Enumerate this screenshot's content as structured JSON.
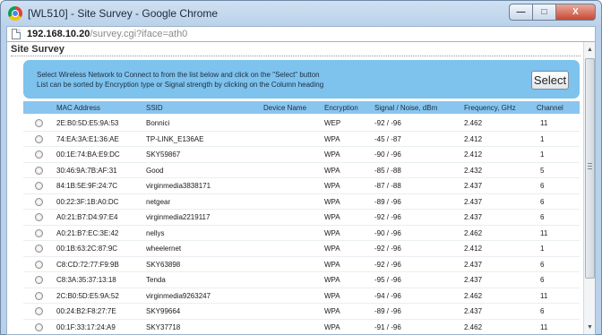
{
  "window": {
    "title": "[WL510] - Site Survey - Google Chrome",
    "controls": {
      "minimize": "—",
      "maximize": "□",
      "close": "X"
    }
  },
  "address": {
    "host": "192.168.10.20",
    "path": "/survey.cgi?iface=ath0"
  },
  "page": {
    "section_title": "Site Survey",
    "info_line1": "Select Wireless Network to Connect to from the list below and click on the \"Select\" button",
    "info_line2": "List can be sorted by Encryption type or Signal strength by clicking on the Column heading",
    "select_label": "Select"
  },
  "table": {
    "headers": {
      "mac": "MAC Address",
      "ssid": "SSID",
      "device": "Device Name",
      "encryption": "Encryption",
      "signal": "Signal / Noise, dBm",
      "frequency": "Frequency, GHz",
      "channel": "Channel"
    },
    "rows": [
      {
        "mac": "2E:B0:5D:E5:9A:53",
        "ssid": "Bonnici",
        "device": "",
        "encryption": "WEP",
        "signal": "-92 / -96",
        "frequency": "2.462",
        "channel": "11"
      },
      {
        "mac": "74:EA:3A:E1:36:AE",
        "ssid": "TP-LINK_E136AE",
        "device": "",
        "encryption": "WPA",
        "signal": "-45 / -87",
        "frequency": "2.412",
        "channel": "1"
      },
      {
        "mac": "00:1E:74:BA:E9:DC",
        "ssid": "SKY59867",
        "device": "",
        "encryption": "WPA",
        "signal": "-90 / -96",
        "frequency": "2.412",
        "channel": "1"
      },
      {
        "mac": "30:46:9A:7B:AF:31",
        "ssid": "Good",
        "device": "",
        "encryption": "WPA",
        "signal": "-85 / -88",
        "frequency": "2.432",
        "channel": "5"
      },
      {
        "mac": "84:1B:5E:9F:24:7C",
        "ssid": "virginmedia3838171",
        "device": "",
        "encryption": "WPA",
        "signal": "-87 / -88",
        "frequency": "2.437",
        "channel": "6"
      },
      {
        "mac": "00:22:3F:1B:A0:DC",
        "ssid": "netgear",
        "device": "",
        "encryption": "WPA",
        "signal": "-89 / -96",
        "frequency": "2.437",
        "channel": "6"
      },
      {
        "mac": "A0:21:B7:D4:97:E4",
        "ssid": "virginmedia2219117",
        "device": "",
        "encryption": "WPA",
        "signal": "-92 / -96",
        "frequency": "2.437",
        "channel": "6"
      },
      {
        "mac": "A0:21:B7:EC:3E:42",
        "ssid": "nellys",
        "device": "",
        "encryption": "WPA",
        "signal": "-90 / -96",
        "frequency": "2.462",
        "channel": "11"
      },
      {
        "mac": "00:1B:63:2C:87:9C",
        "ssid": "wheelernet",
        "device": "",
        "encryption": "WPA",
        "signal": "-92 / -96",
        "frequency": "2.412",
        "channel": "1"
      },
      {
        "mac": "C8:CD:72:77:F9:9B",
        "ssid": "SKY63898",
        "device": "",
        "encryption": "WPA",
        "signal": "-92 / -96",
        "frequency": "2.437",
        "channel": "6"
      },
      {
        "mac": "C8:3A:35:37:13:18",
        "ssid": "Tenda",
        "device": "",
        "encryption": "WPA",
        "signal": "-95 / -96",
        "frequency": "2.437",
        "channel": "6"
      },
      {
        "mac": "2C:B0:5D:E5:9A:52",
        "ssid": "virginmedia9263247",
        "device": "",
        "encryption": "WPA",
        "signal": "-94 / -96",
        "frequency": "2.462",
        "channel": "11"
      },
      {
        "mac": "00:24:B2:F8:27:7E",
        "ssid": "SKY99664",
        "device": "",
        "encryption": "WPA",
        "signal": "-89 / -96",
        "frequency": "2.437",
        "channel": "6"
      },
      {
        "mac": "00:1F:33:17:24:A9",
        "ssid": "SKY37718",
        "device": "",
        "encryption": "WPA",
        "signal": "-91 / -96",
        "frequency": "2.462",
        "channel": "11"
      }
    ]
  },
  "scrollbar": {
    "up_icon": "▲",
    "down_icon": "▼"
  },
  "colors": {
    "info_box": "#7ec2ee",
    "header_row": "#89c5ef",
    "title_bar": "#b9d1ea",
    "close_button": "#c74a35"
  }
}
